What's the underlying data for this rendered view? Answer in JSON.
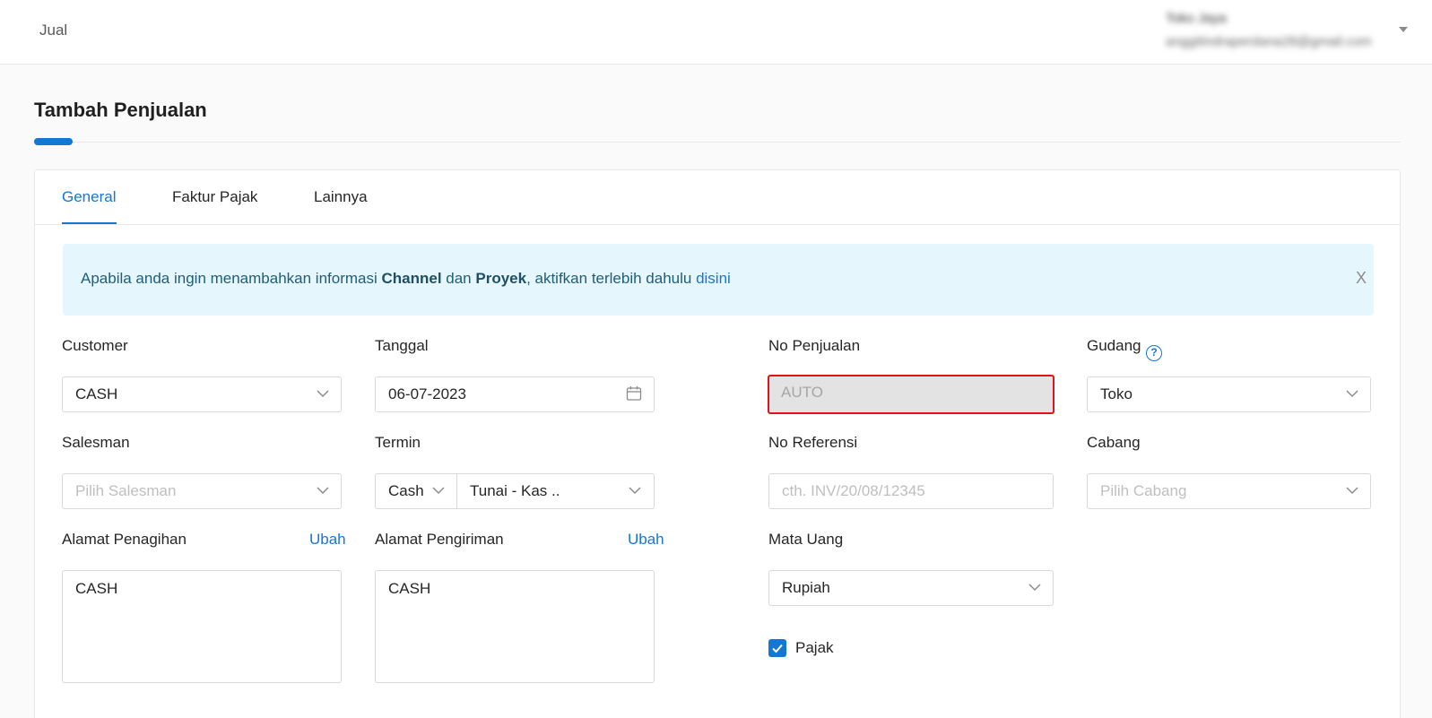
{
  "topbar": {
    "breadcrumb": "Jual",
    "user_name": "Toko Jaya",
    "user_email": "anggitindraperdana28@gmail.com"
  },
  "page": {
    "title": "Tambah Penjualan"
  },
  "tabs": [
    {
      "label": "General",
      "active": true
    },
    {
      "label": "Faktur Pajak",
      "active": false
    },
    {
      "label": "Lainnya",
      "active": false
    }
  ],
  "alert": {
    "text_1": "Apabila anda ingin menambahkan informasi ",
    "channel": "Channel",
    "text_2": " dan ",
    "proyek": "Proyek",
    "text_3": ", aktifkan terlebih dahulu ",
    "link": "disini",
    "close": "X"
  },
  "form": {
    "customer": {
      "label": "Customer",
      "value": "CASH"
    },
    "tanggal": {
      "label": "Tanggal",
      "value": "06-07-2023"
    },
    "no_penjualan": {
      "label": "No Penjualan",
      "value": "AUTO"
    },
    "gudang": {
      "label": "Gudang",
      "value": "Toko",
      "help": "?"
    },
    "salesman": {
      "label": "Salesman",
      "placeholder": "Pilih Salesman"
    },
    "termin": {
      "label": "Termin",
      "type_value": "Cash",
      "value": "Tunai - Kas .."
    },
    "no_referensi": {
      "label": "No Referensi",
      "placeholder": "cth. INV/20/08/12345"
    },
    "cabang": {
      "label": "Cabang",
      "placeholder": "Pilih Cabang"
    },
    "alamat_penagihan": {
      "label": "Alamat Penagihan",
      "action": "Ubah",
      "value": "CASH"
    },
    "alamat_pengiriman": {
      "label": "Alamat Pengiriman",
      "action": "Ubah",
      "value": "CASH"
    },
    "mata_uang": {
      "label": "Mata Uang",
      "value": "Rupiah"
    },
    "pajak": {
      "label": "Pajak",
      "checked": true
    }
  },
  "colors": {
    "accent": "#1677d2",
    "alert_bg": "#e6f6fd",
    "highlight_border": "#e01414"
  }
}
